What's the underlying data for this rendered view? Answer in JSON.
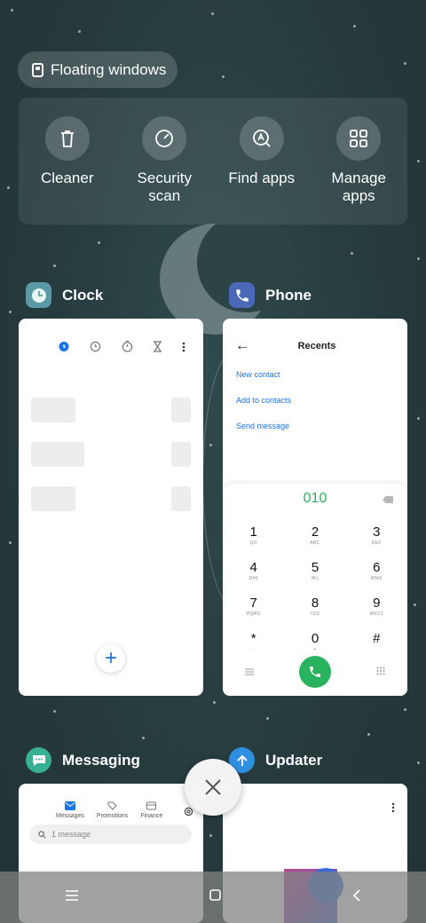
{
  "floating_windows": {
    "label": "Floating windows"
  },
  "tools": [
    {
      "label": "Cleaner",
      "icon": "trash-icon"
    },
    {
      "label": "Security\nscan",
      "icon": "security-scan-icon"
    },
    {
      "label": "Find apps",
      "icon": "find-apps-icon"
    },
    {
      "label": "Manage\napps",
      "icon": "manage-apps-icon"
    }
  ],
  "apps": {
    "clock": {
      "name": "Clock",
      "color": "#5a9aa6"
    },
    "phone": {
      "name": "Phone",
      "color": "#4a67b8"
    },
    "messaging": {
      "name": "Messaging",
      "color": "#38b094"
    },
    "updater": {
      "name": "Updater",
      "color": "#2f8fe0"
    }
  },
  "phone_card": {
    "title": "Recents",
    "links": [
      "New contact",
      "Add to contacts",
      "Send message"
    ],
    "dialed_number": "010",
    "keys": [
      {
        "digit": "1",
        "letters": "QO"
      },
      {
        "digit": "2",
        "letters": "ABC"
      },
      {
        "digit": "3",
        "letters": "DEF"
      },
      {
        "digit": "4",
        "letters": "GHI"
      },
      {
        "digit": "5",
        "letters": "JKL"
      },
      {
        "digit": "6",
        "letters": "MNO"
      },
      {
        "digit": "7",
        "letters": "PQRS"
      },
      {
        "digit": "8",
        "letters": "TUV"
      },
      {
        "digit": "9",
        "letters": "WXYZ"
      },
      {
        "digit": "*",
        "letters": ","
      },
      {
        "digit": "0",
        "letters": "+"
      },
      {
        "digit": "#",
        "letters": ""
      }
    ]
  },
  "messaging_card": {
    "tabs": [
      "Messages",
      "Promotions",
      "Finance"
    ],
    "search_text": "1 message"
  },
  "colors": {
    "accent_green": "#2ab35e",
    "accent_blue": "#1a73e8"
  }
}
